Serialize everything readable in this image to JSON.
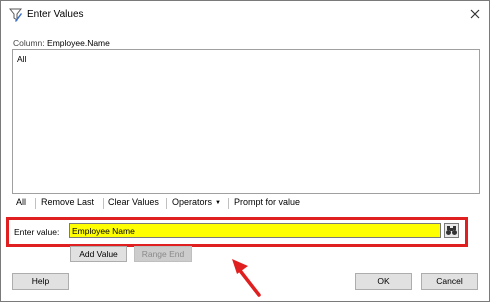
{
  "window": {
    "title": "Enter Values",
    "close_glyph": "✕"
  },
  "column": {
    "label": "Column:",
    "name": "Employee.Name"
  },
  "list": {
    "items": [
      "All"
    ]
  },
  "toolbar": {
    "all": "All",
    "remove_last": "Remove Last",
    "clear_values": "Clear Values",
    "operators": "Operators",
    "prompt_for_value": "Prompt for value"
  },
  "entry": {
    "label": "Enter value:",
    "value": "Employee Name",
    "input_background": "#ffff00",
    "highlight_color": "#e02020",
    "picker_icon": "binoculars-icon"
  },
  "buttons": {
    "add_value": "Add Value",
    "range_end": "Range End",
    "help": "Help",
    "ok": "OK",
    "cancel": "Cancel"
  },
  "annotation": {
    "icon": "red-arrow-icon",
    "color": "#e02020"
  }
}
